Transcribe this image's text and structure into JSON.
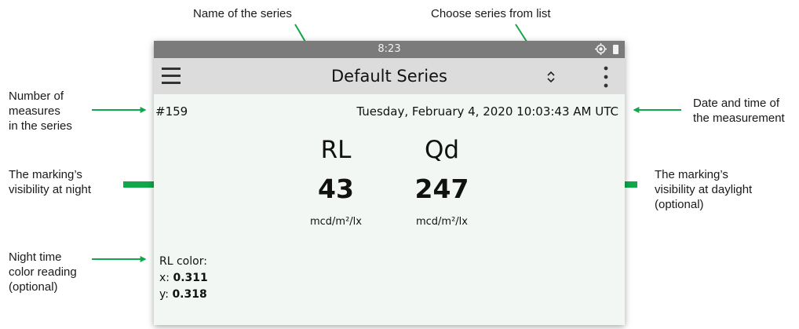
{
  "callouts": {
    "series_name": "Name of the series",
    "choose_series": "Choose series from list",
    "measure_count": [
      "Number of",
      "measures",
      "in the series"
    ],
    "datetime": [
      "Date and time of",
      "the measurement"
    ],
    "rl_night": [
      "The marking’s",
      "visibility at night"
    ],
    "qd_day": [
      "The marking’s",
      "visibility at daylight",
      "(optional)"
    ],
    "night_color": [
      "Night time",
      "color reading",
      "(optional)"
    ]
  },
  "status_bar": {
    "time": "8:23",
    "icons": [
      "location-icon",
      "battery-icon"
    ]
  },
  "toolbar": {
    "series_title": "Default Series",
    "icons": [
      "hamburger-menu-icon",
      "up-down-chevron-icon",
      "vertical-dots-menu-icon"
    ]
  },
  "measurement": {
    "count": "#159",
    "datetime": "Tuesday, February 4, 2020 10:03:43 AM UTC",
    "rl": {
      "label": "RL",
      "value": "43",
      "unit": "mcd/m²/lx"
    },
    "qd": {
      "label": "Qd",
      "value": "247",
      "unit": "mcd/m²/lx"
    },
    "rl_color": {
      "title": "RL color:",
      "x_label": "x:",
      "x_value": "0.311",
      "y_label": "y:",
      "y_value": "0.318"
    }
  },
  "colors": {
    "arrow": "#10a84a",
    "status_bar": "#7b7b7b",
    "toolbar": "#dcdcdc",
    "screen_bg": "#f3f7f3"
  }
}
